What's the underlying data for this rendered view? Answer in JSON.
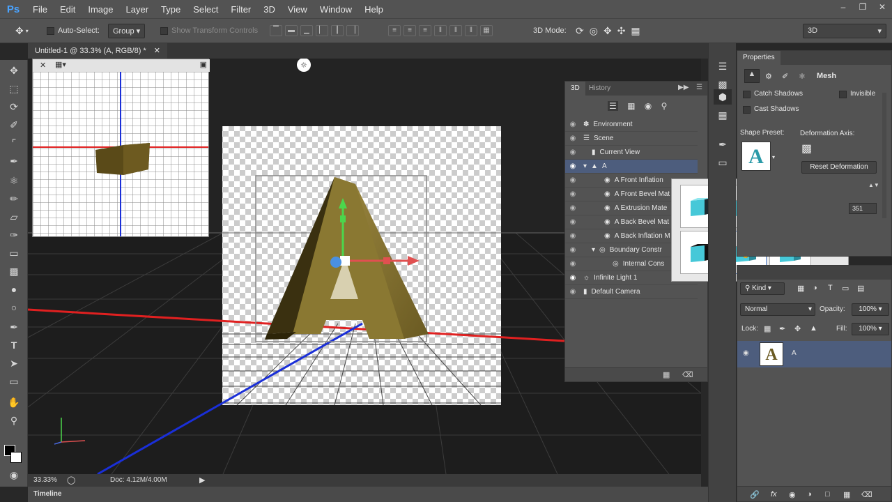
{
  "app": {
    "logo": "Ps"
  },
  "menu": [
    "File",
    "Edit",
    "Image",
    "Layer",
    "Type",
    "Select",
    "Filter",
    "3D",
    "View",
    "Window",
    "Help"
  ],
  "window_controls": [
    "minimize-icon",
    "restore-icon",
    "close-icon"
  ],
  "options": {
    "auto_select_label": "Auto-Select:",
    "auto_select_value": "Group",
    "show_transform_label": "Show Transform Controls",
    "mode3d_label": "3D Mode:",
    "workspace": "3D"
  },
  "document": {
    "tab_title": "Untitled-1 @ 33.3% (A, RGB/8) *",
    "zoom": "33.33%",
    "doc_size": "Doc: 4.12M/4.00M"
  },
  "timeline_label": "Timeline",
  "panel3d": {
    "tabs": [
      "3D",
      "History"
    ],
    "rows": [
      {
        "label": "Environment",
        "indent": 0
      },
      {
        "label": "Scene",
        "indent": 0
      },
      {
        "label": "Current View",
        "indent": 1
      },
      {
        "label": "A",
        "indent": 1,
        "selected": true
      },
      {
        "label": "A Front Inflation",
        "indent": 2
      },
      {
        "label": "A Front Bevel Mat",
        "indent": 2
      },
      {
        "label": "A Extrusion Mate",
        "indent": 2
      },
      {
        "label": "A Back Bevel Mat",
        "indent": 2
      },
      {
        "label": "A Back Inflation M",
        "indent": 2
      },
      {
        "label": "Boundary Constr",
        "indent": 2
      },
      {
        "label": "Internal Cons",
        "indent": 3
      },
      {
        "label": "Infinite Light 1",
        "indent": 0
      },
      {
        "label": "Default Camera",
        "indent": 0
      }
    ]
  },
  "properties": {
    "title": "Properties",
    "mode": "Mesh",
    "catch_shadows": "Catch Shadows",
    "cast_shadows": "Cast Shadows",
    "invisible": "Invisible",
    "shape_preset_label": "Shape Preset:",
    "deformation_axis_label": "Deformation Axis:",
    "reset_button": "Reset Deformation",
    "value_field": "351",
    "preset_letter": "A"
  },
  "layers": {
    "kind_label": "Kind",
    "blend_mode": "Normal",
    "opacity_label": "Opacity:",
    "opacity_value": "100%",
    "lock_label": "Lock:",
    "fill_label": "Fill:",
    "fill_value": "100%",
    "layer_name": "A",
    "fx": "fx"
  },
  "colors": {
    "accent": "#4aa3ff",
    "selection": "#4d5d7d",
    "cube": "#46c8d8"
  }
}
